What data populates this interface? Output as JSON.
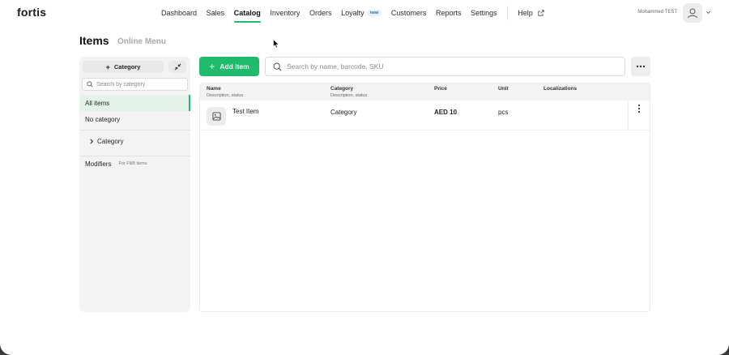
{
  "brand": {
    "logo": "fortis"
  },
  "nav": {
    "items": [
      {
        "label": "Dashboard"
      },
      {
        "label": "Sales"
      },
      {
        "label": "Catalog"
      },
      {
        "label": "Inventory"
      },
      {
        "label": "Orders"
      },
      {
        "label": "Loyalty",
        "badge": "new"
      },
      {
        "label": "Customers"
      },
      {
        "label": "Reports"
      },
      {
        "label": "Settings"
      }
    ],
    "help": "Help",
    "active": "Catalog"
  },
  "user": {
    "name": "Mohammed TEST"
  },
  "page": {
    "title": "Items",
    "alt_tab": "Online Menu"
  },
  "sidebar": {
    "add_category": "Category",
    "search_placeholder": "Search by category",
    "items": [
      {
        "label": "All items",
        "selected": true
      },
      {
        "label": "No category"
      },
      {
        "label": "Category"
      },
      {
        "label": "Modifiers",
        "sub": "For F&B items"
      }
    ]
  },
  "toolbar": {
    "add_item": "Add item",
    "search_placeholder": "Search by name, barcode, SKU"
  },
  "table": {
    "columns": [
      {
        "label": "Name",
        "sub": "Description, status"
      },
      {
        "label": "Category",
        "sub": "Description, status"
      },
      {
        "label": "Price"
      },
      {
        "label": "Unit"
      },
      {
        "label": "Localizations"
      }
    ],
    "rows": [
      {
        "name": "Test Item",
        "category": "Category",
        "price": "AED 10",
        "unit": "pcs",
        "localizations": ""
      }
    ]
  },
  "colors": {
    "accent": "#1fba6c",
    "selected_bg": "#e4f3ea",
    "badge_bg": "#e3f1fb"
  },
  "icons": {
    "search": "search-icon",
    "external_link": "external-link-icon",
    "avatar": "user-icon",
    "collapse": "collapse-icon",
    "image_placeholder": "image-icon",
    "row_menu": "vertical-dots-icon",
    "chevron": "chevron-right-icon"
  }
}
